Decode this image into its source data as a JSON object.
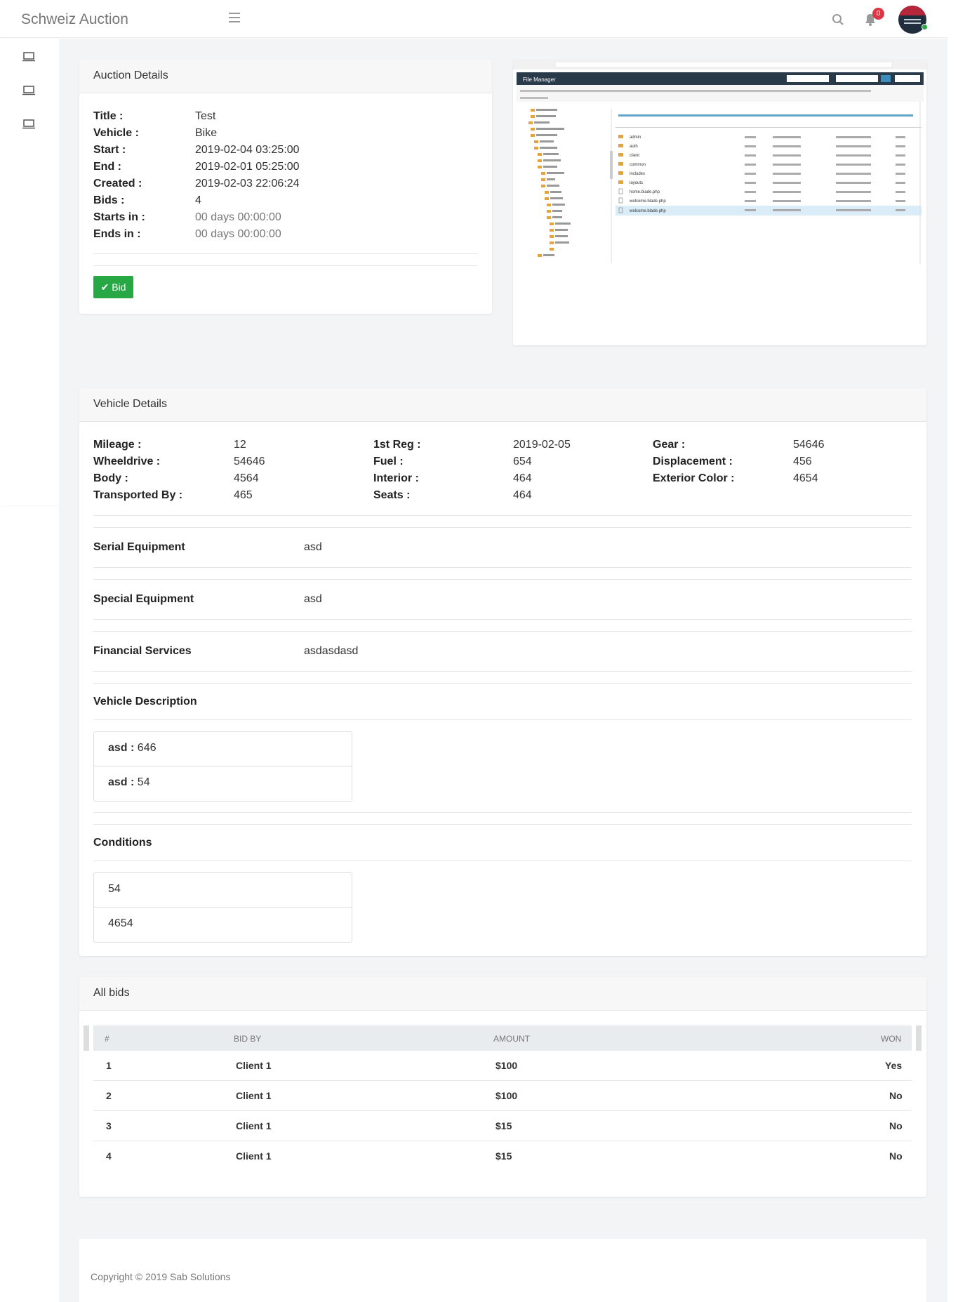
{
  "topbar": {
    "brand": "Schweiz Auction",
    "notification_count": "0"
  },
  "sidebar": {
    "items": [
      {
        "icon": "laptop-icon"
      },
      {
        "icon": "laptop-icon"
      },
      {
        "icon": "laptop-icon"
      }
    ]
  },
  "auction": {
    "header": "Auction Details",
    "rows": [
      {
        "label": "Title :",
        "value": "Test"
      },
      {
        "label": "Vehicle :",
        "value": "Bike"
      },
      {
        "label": "Start :",
        "value": "2019-02-04 03:25:00"
      },
      {
        "label": "End :",
        "value": "2019-02-01 05:25:00"
      },
      {
        "label": "Created :",
        "value": "2019-02-03 22:06:24"
      },
      {
        "label": "Bids :",
        "value": "4"
      },
      {
        "label": "Starts in :",
        "value": "00 days 00:00:00"
      },
      {
        "label": "Ends in :",
        "value": "00 days 00:00:00"
      }
    ],
    "bid_button": "Bid"
  },
  "thumbnail": {
    "title": "File Manager",
    "folders": [
      "admin",
      "auth",
      "client",
      "common",
      "includes",
      "layouts"
    ],
    "files": [
      "home.blade.php",
      "welcome.blade.php",
      "welcome.blade.php"
    ]
  },
  "vehicle": {
    "header": "Vehicle Details",
    "specs": [
      [
        {
          "label": "Mileage :",
          "value": "12"
        },
        {
          "label": "1st Reg :",
          "value": "2019-02-05"
        },
        {
          "label": "Gear :",
          "value": "54646"
        }
      ],
      [
        {
          "label": "Wheeldrive :",
          "value": "54646"
        },
        {
          "label": "Fuel :",
          "value": "654"
        },
        {
          "label": "Displacement :",
          "value": "456"
        }
      ],
      [
        {
          "label": "Body :",
          "value": "4564"
        },
        {
          "label": "Interior :",
          "value": "464"
        },
        {
          "label": "Exterior Color :",
          "value": "4654"
        }
      ],
      [
        {
          "label": "Transported By :",
          "value": "465"
        },
        {
          "label": "Seats :",
          "value": "464"
        }
      ]
    ],
    "serial_equipment": {
      "label": "Serial Equipment",
      "value": "asd"
    },
    "special_equipment": {
      "label": "Special Equipment",
      "value": "asd"
    },
    "financial_services": {
      "label": "Financial Services",
      "value": "asdasdasd"
    },
    "description": {
      "label": "Vehicle Description",
      "items": [
        {
          "key": "asd :",
          "value": "646"
        },
        {
          "key": "asd :",
          "value": "54"
        }
      ]
    },
    "conditions": {
      "label": "Conditions",
      "items": [
        "54",
        "4654"
      ]
    }
  },
  "bids": {
    "header": "All bids",
    "columns": [
      "#",
      "BID BY",
      "AMOUNT",
      "WON"
    ],
    "rows": [
      {
        "num": "1",
        "by": "Client 1",
        "amount": "$100",
        "won": "Yes"
      },
      {
        "num": "2",
        "by": "Client 1",
        "amount": "$100",
        "won": "No"
      },
      {
        "num": "3",
        "by": "Client 1",
        "amount": "$15",
        "won": "No"
      },
      {
        "num": "4",
        "by": "Client 1",
        "amount": "$15",
        "won": "No"
      }
    ]
  },
  "footer": {
    "text": "Copyright © 2019 Sab Solutions"
  }
}
